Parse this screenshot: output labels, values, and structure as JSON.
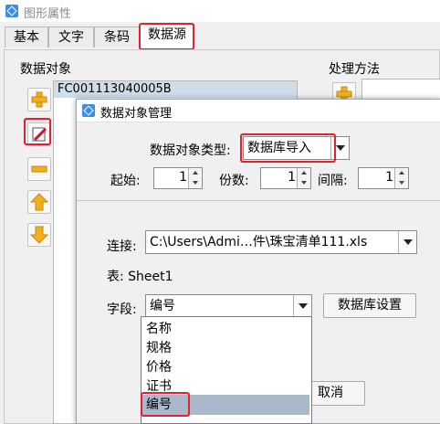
{
  "window": {
    "title": "图形属性"
  },
  "tabs": [
    {
      "label": "基本"
    },
    {
      "label": "文字"
    },
    {
      "label": "条码"
    },
    {
      "label": "数据源"
    }
  ],
  "left_panel": {
    "section_label": "数据对象",
    "selected_item": "FC001113040005B",
    "buttons": [
      "add-icon",
      "edit-icon",
      "remove-icon",
      "move-up-icon",
      "move-down-icon"
    ]
  },
  "right_panel": {
    "section_label": "处理方法"
  },
  "dialog": {
    "title": "数据对象管理",
    "type_label": "数据对象类型:",
    "type_value": "数据库导入",
    "start_label": "起始:",
    "start_value": "1",
    "copies_label": "份数:",
    "copies_value": "1",
    "interval_label": "间隔:",
    "interval_value": "1",
    "connection_label": "连接:",
    "connection_value": "C:\\Users\\Admi…件\\珠宝清单111.xls",
    "table_text": "表: Sheet1",
    "field_label": "字段:",
    "field_value": "编号",
    "db_settings_button": "数据库设置",
    "cancel_button": "取消",
    "field_options": [
      "名称",
      "规格",
      "价格",
      "证书",
      "编号"
    ],
    "selected_option": "编号"
  },
  "colors": {
    "highlight": "#e4202e",
    "list_selection": "#a9b8cb"
  }
}
